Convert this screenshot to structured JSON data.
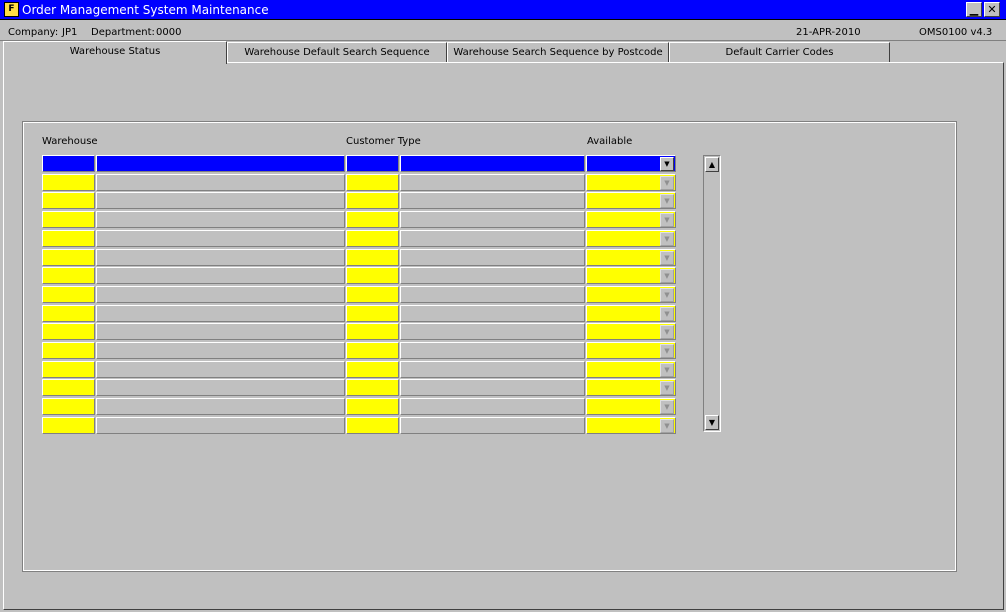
{
  "window": {
    "title": "Order Management System Maintenance",
    "icon": "form-app-icon",
    "minimize_glyph": "▁",
    "close_glyph": "✕"
  },
  "status": {
    "company_label": "Company:",
    "company_value": "JP1",
    "department_label": "Department:",
    "department_value": "0000",
    "date": "21-APR-2010",
    "version": "OMS0100  v4.3"
  },
  "tabs": [
    {
      "label": "Warehouse Status",
      "active": true
    },
    {
      "label": "Warehouse Default Search Sequence",
      "active": false
    },
    {
      "label": "Warehouse Search Sequence by Postcode",
      "active": false
    },
    {
      "label": "Default Carrier Codes",
      "active": false
    }
  ],
  "grid": {
    "columns": {
      "warehouse": "Warehouse",
      "customer_type": "Customer Type",
      "available": "Available"
    },
    "row_count": 15,
    "selected_row": 1,
    "rows": [
      {
        "warehouse": "",
        "warehouse_desc": "",
        "customer_type": "",
        "customer_type_desc": "",
        "available": ""
      },
      {
        "warehouse": "",
        "warehouse_desc": "",
        "customer_type": "",
        "customer_type_desc": "",
        "available": ""
      },
      {
        "warehouse": "",
        "warehouse_desc": "",
        "customer_type": "",
        "customer_type_desc": "",
        "available": ""
      },
      {
        "warehouse": "",
        "warehouse_desc": "",
        "customer_type": "",
        "customer_type_desc": "",
        "available": ""
      },
      {
        "warehouse": "",
        "warehouse_desc": "",
        "customer_type": "",
        "customer_type_desc": "",
        "available": ""
      },
      {
        "warehouse": "",
        "warehouse_desc": "",
        "customer_type": "",
        "customer_type_desc": "",
        "available": ""
      },
      {
        "warehouse": "",
        "warehouse_desc": "",
        "customer_type": "",
        "customer_type_desc": "",
        "available": ""
      },
      {
        "warehouse": "",
        "warehouse_desc": "",
        "customer_type": "",
        "customer_type_desc": "",
        "available": ""
      },
      {
        "warehouse": "",
        "warehouse_desc": "",
        "customer_type": "",
        "customer_type_desc": "",
        "available": ""
      },
      {
        "warehouse": "",
        "warehouse_desc": "",
        "customer_type": "",
        "customer_type_desc": "",
        "available": ""
      },
      {
        "warehouse": "",
        "warehouse_desc": "",
        "customer_type": "",
        "customer_type_desc": "",
        "available": ""
      },
      {
        "warehouse": "",
        "warehouse_desc": "",
        "customer_type": "",
        "customer_type_desc": "",
        "available": ""
      },
      {
        "warehouse": "",
        "warehouse_desc": "",
        "customer_type": "",
        "customer_type_desc": "",
        "available": ""
      },
      {
        "warehouse": "",
        "warehouse_desc": "",
        "customer_type": "",
        "customer_type_desc": "",
        "available": ""
      },
      {
        "warehouse": "",
        "warehouse_desc": "",
        "customer_type": "",
        "customer_type_desc": "",
        "available": ""
      }
    ]
  },
  "colors": {
    "title_bar": "#0000ff",
    "required_field": "#ffff00",
    "current_record": "#0000ff",
    "display_field": "#c0c0c0",
    "canvas": "#c0c0c0"
  },
  "icons": {
    "dropdown": "chevron-down-icon",
    "scroll_up": "arrow-up-icon",
    "scroll_down": "arrow-down-icon"
  }
}
